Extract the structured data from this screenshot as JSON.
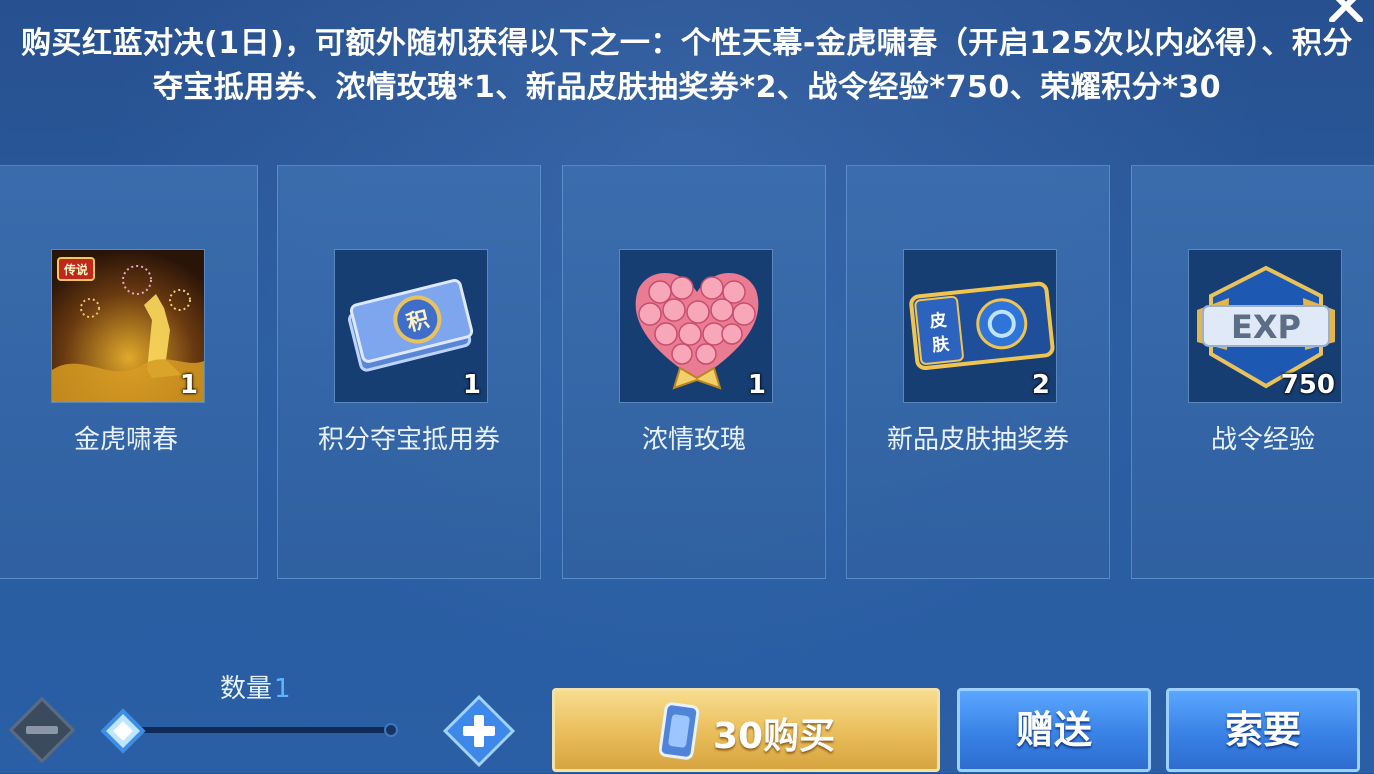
{
  "description": "购买红蓝对决(1日)，可额外随机获得以下之一：个性天幕-金虎啸春（开启125次以内必得）、积分夺宝抵用券、浓情玫瑰*1、新品皮肤抽奖券*2、战令经验*750、荣耀积分*30",
  "items": [
    {
      "name": "金虎啸春",
      "qty": "1",
      "icon": "golden-tiger-icon"
    },
    {
      "name": "积分夺宝抵用券",
      "qty": "1",
      "icon": "voucher-ticket-icon"
    },
    {
      "name": "浓情玫瑰",
      "qty": "1",
      "icon": "rose-bouquet-icon"
    },
    {
      "name": "新品皮肤抽奖券",
      "qty": "2",
      "icon": "skin-lottery-ticket-icon"
    },
    {
      "name": "战令经验",
      "qty": "750",
      "icon": "exp-badge-icon"
    }
  ],
  "quantity": {
    "label": "数量",
    "value": "1"
  },
  "buttons": {
    "buy": "30购买",
    "gift": "赠送",
    "request": "索要"
  },
  "colors": {
    "accent_gold": "#e9bd5a",
    "accent_blue": "#3a82e6",
    "quantity_value": "#5fb4ff"
  }
}
